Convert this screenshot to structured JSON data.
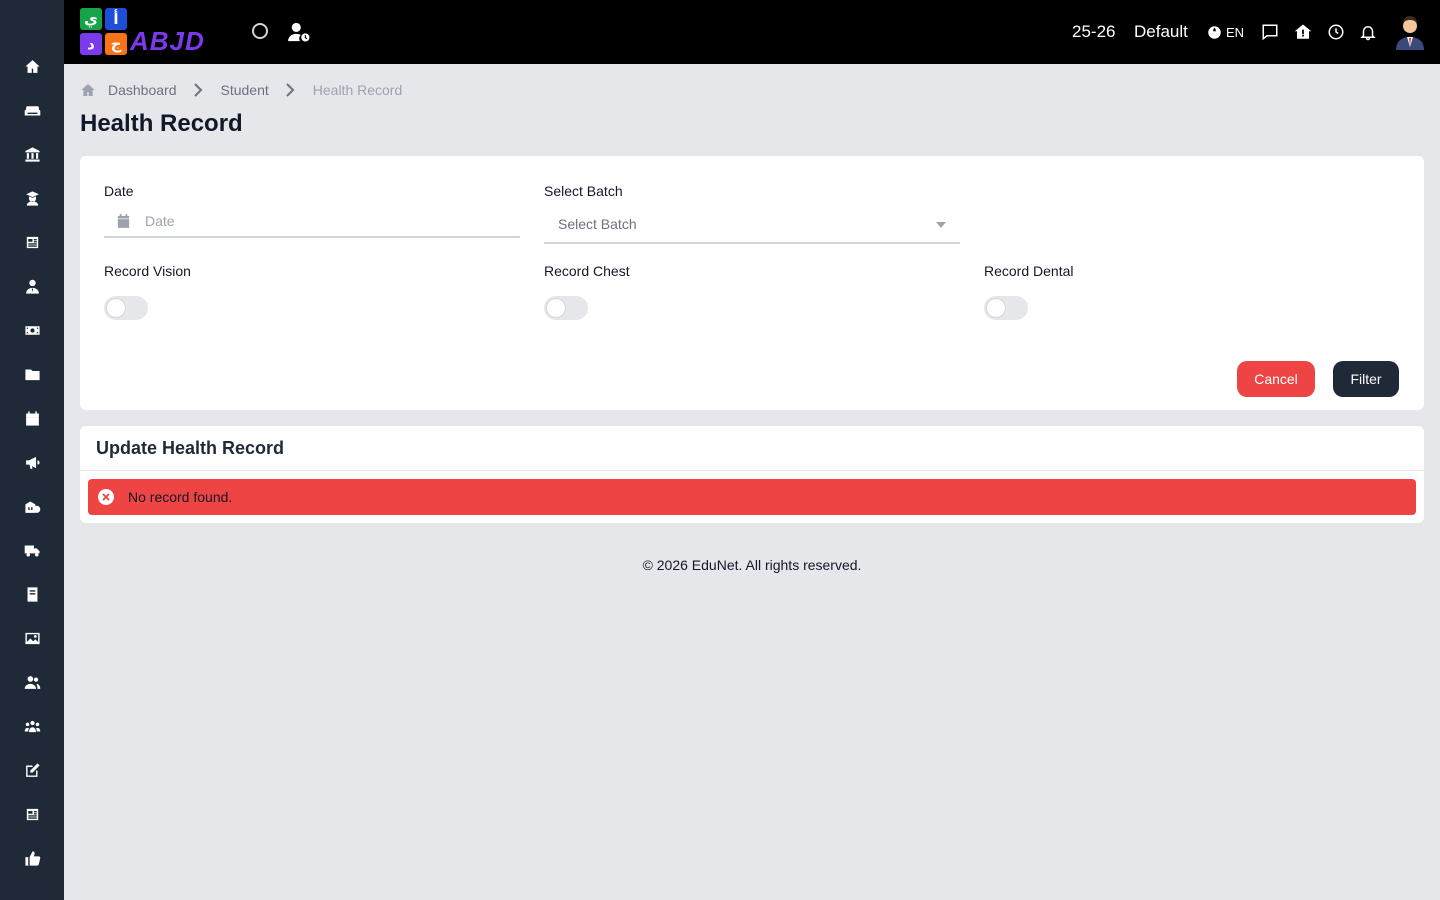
{
  "app": {
    "logo_text": "ABJD",
    "logo_tiles": [
      "ي",
      "أ",
      "د",
      "ج"
    ]
  },
  "topbar": {
    "session": "25-26",
    "school": "Default",
    "language": "EN"
  },
  "sidebar": {
    "items": [
      {
        "icon": "home-icon"
      },
      {
        "icon": "sofa-icon"
      },
      {
        "icon": "institution-icon"
      },
      {
        "icon": "graduate-icon"
      },
      {
        "icon": "newspaper-icon"
      },
      {
        "icon": "user-tie-icon"
      },
      {
        "icon": "money-icon"
      },
      {
        "icon": "folder-icon"
      },
      {
        "icon": "calendar-icon"
      },
      {
        "icon": "megaphone-icon"
      },
      {
        "icon": "school-icon"
      },
      {
        "icon": "truck-icon"
      },
      {
        "icon": "book-icon"
      },
      {
        "icon": "image-icon"
      },
      {
        "icon": "users-icon"
      },
      {
        "icon": "people-group-icon"
      },
      {
        "icon": "edit-icon"
      },
      {
        "icon": "news-icon"
      },
      {
        "icon": "thumbs-up-icon"
      }
    ]
  },
  "breadcrumb": {
    "items": [
      "Dashboard",
      "Student",
      "Health Record"
    ]
  },
  "page": {
    "title": "Health Record"
  },
  "filters": {
    "date_label": "Date",
    "date_placeholder": "Date",
    "batch_label": "Select Batch",
    "batch_value": "Select Batch",
    "vision_label": "Record Vision",
    "chest_label": "Record Chest",
    "dental_label": "Record Dental",
    "vision_on": false,
    "chest_on": false,
    "dental_on": false,
    "cancel_label": "Cancel",
    "filter_label": "Filter"
  },
  "update": {
    "title": "Update Health Record",
    "alert_text": "No record found."
  },
  "footer": {
    "text": "© 2026 EduNet. All rights reserved."
  },
  "colors": {
    "sidebar": "#1f2937",
    "topbar": "#000000",
    "danger": "#ef4444",
    "dark_button": "#1f2937",
    "background": "#e5e7eb"
  }
}
